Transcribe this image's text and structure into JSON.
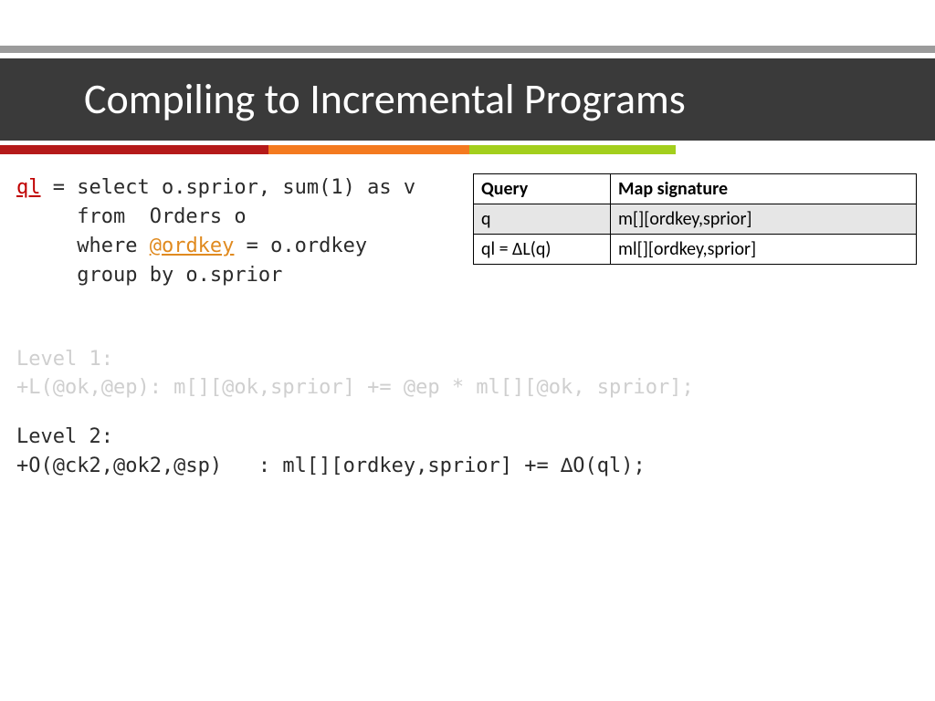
{
  "title": "Compiling to Incremental Programs",
  "query": {
    "ql": "ql",
    "eq": " = select o.sprior, sum(1) as v",
    "from": "     from  Orders o",
    "where_pre": "     where ",
    "ordkey": "@ordkey",
    "where_post": " = o.ordkey",
    "group": "     group by o.sprior"
  },
  "table": {
    "headers": [
      "Query",
      "Map signature"
    ],
    "rows": [
      [
        "q",
        "m[][ordkey,sprior]"
      ],
      [
        "ql = ∆L(q)",
        "ml[][ordkey,sprior]"
      ]
    ]
  },
  "level1": {
    "label": "Level 1:",
    "line": "+L(@ok,@ep): m[][@ok,sprior] += @ep * ml[][@ok, sprior];"
  },
  "level2": {
    "label": "Level 2:",
    "line": "+O(@ck2,@ok2,@sp)   : ml[][ordkey,sprior] += ∆O(ql);"
  }
}
